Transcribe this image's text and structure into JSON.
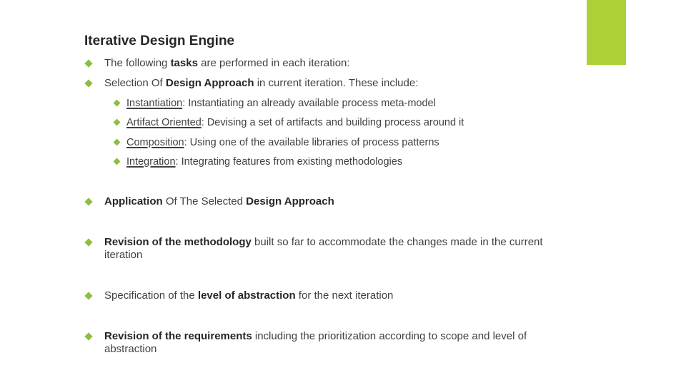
{
  "slide": {
    "title": "Iterative Design Engine",
    "accent_color": "#acd136",
    "bullet_color": "#8bbf3f",
    "bullets": [
      {
        "parts": [
          "The following ",
          "tasks",
          " are performed in each iteration:"
        ]
      },
      {
        "parts": [
          "Selection Of ",
          "Design Approach",
          " in current iteration. These include:"
        ],
        "sub_items": [
          {
            "term": "Instantiation",
            "text": ": Instantiating an already available process meta-model"
          },
          {
            "term": "Artifact Oriented",
            "text": ": Devising a set of artifacts and building process around it"
          },
          {
            "term": "Composition",
            "text": ": Using one of the available libraries of process patterns"
          },
          {
            "term": "Integration",
            "text": ": Integrating features from existing methodologies"
          }
        ]
      },
      {
        "parts": [
          "Application",
          " Of The Selected ",
          "Design Approach"
        ]
      },
      {
        "parts": [
          "Revision of the methodology",
          " built so far to accommodate the changes made in the current iteration"
        ]
      },
      {
        "parts": [
          "Specification of the ",
          "level of abstraction",
          " for the next iteration"
        ]
      },
      {
        "parts": [
          "Revision of the requirements",
          " including the prioritization according to scope and level of abstraction"
        ]
      }
    ]
  }
}
